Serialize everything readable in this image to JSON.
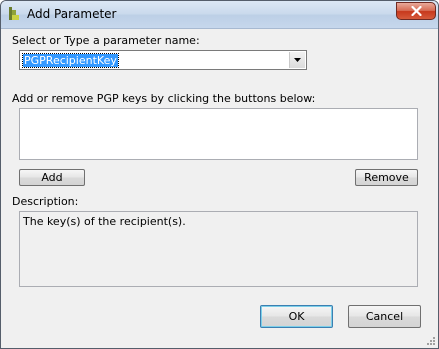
{
  "window": {
    "title": "Add Parameter"
  },
  "parameter": {
    "select_label": "Select or Type a parameter name:",
    "selected_value": "PGPRecipientKey"
  },
  "keys": {
    "instruction_label": "Add or remove PGP keys by clicking the buttons below:",
    "add_label": "Add",
    "remove_label": "Remove"
  },
  "description": {
    "label": "Description:",
    "text": "The key(s) of the recipient(s)."
  },
  "dialog_buttons": {
    "ok_label": "OK",
    "cancel_label": "Cancel"
  },
  "icons": {
    "app": "app-icon",
    "close": "close-icon",
    "dropdown": "chevron-down-icon",
    "resize": "resize-grip-icon"
  },
  "colors": {
    "selection": "#3399ff",
    "dialog_background": "#f0f0f0",
    "close_button": "#c7381c"
  }
}
